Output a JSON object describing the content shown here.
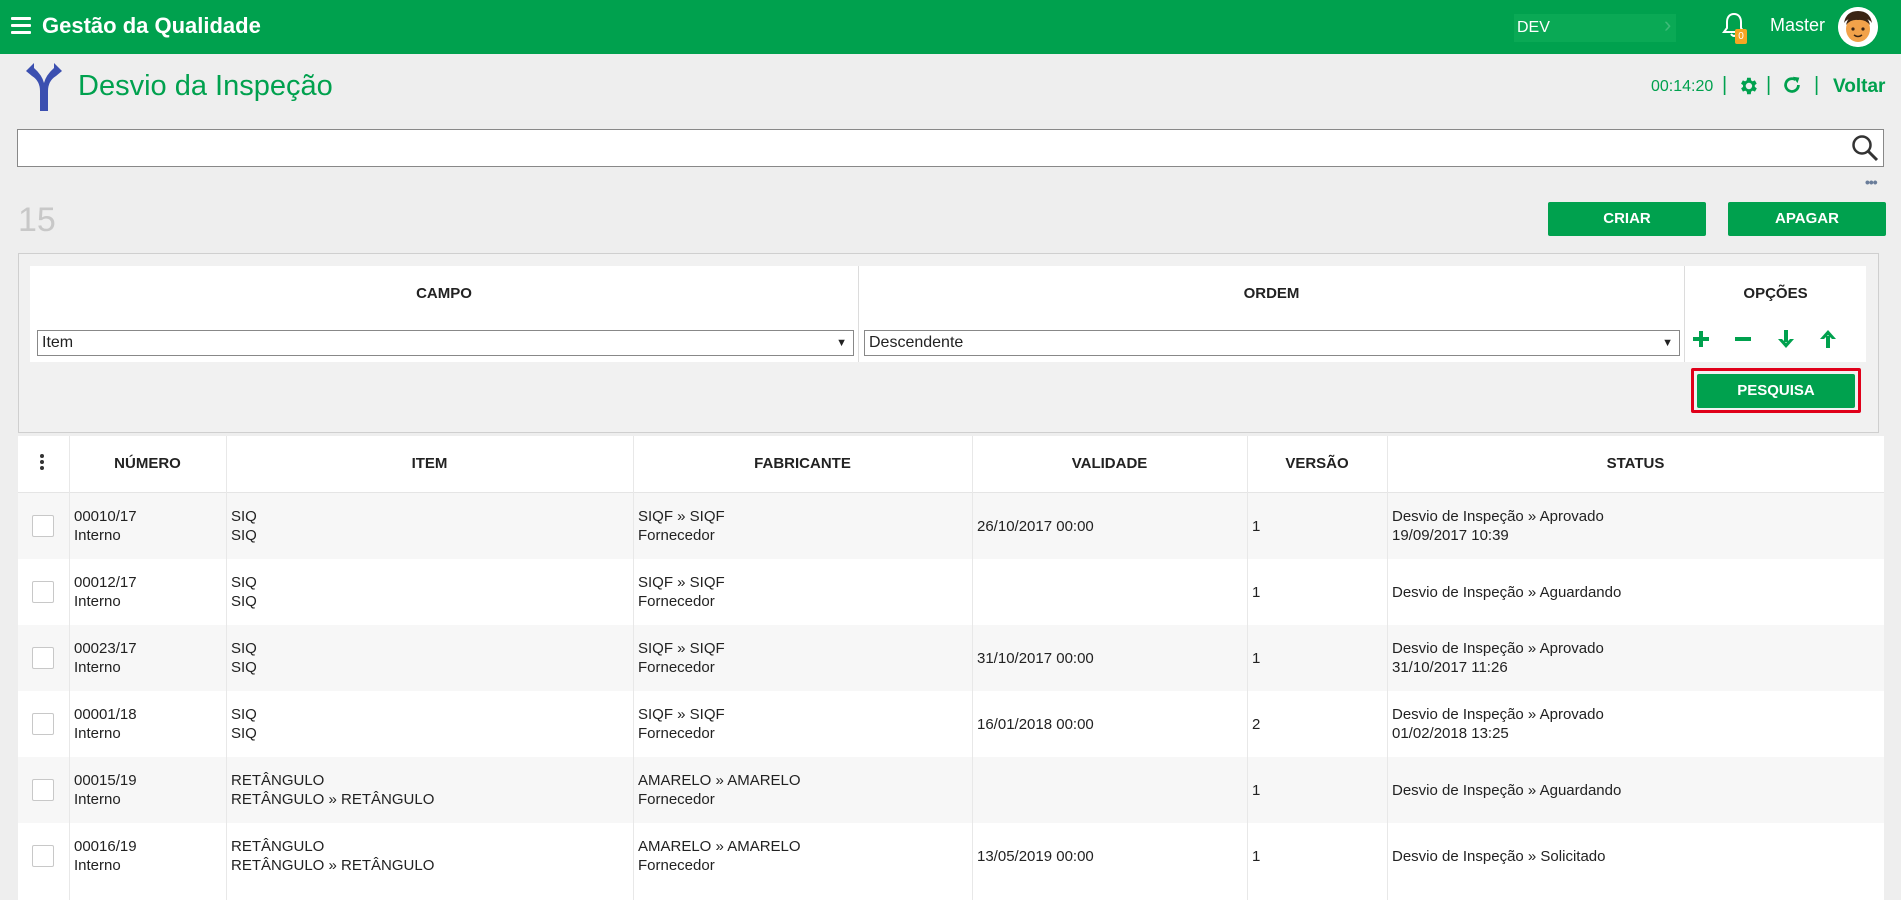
{
  "topbar": {
    "app_title": "Gestão da Qualidade",
    "env": "DEV",
    "notification_count": "0",
    "user": "Master"
  },
  "header": {
    "title": "Desvio da Inspeção",
    "timer": "00:14:20",
    "separator": "|",
    "back_label": "Voltar"
  },
  "search": {
    "value": "",
    "placeholder": ""
  },
  "count": "15",
  "actions": {
    "create": "CRIAR",
    "delete": "APAGAR",
    "search": "PESQUISA"
  },
  "sort": {
    "columns": [
      "CAMPO",
      "ORDEM",
      "OPÇÕES"
    ],
    "field_value": "Item",
    "order_value": "Descendente"
  },
  "table": {
    "columns": [
      "NÚMERO",
      "ITEM",
      "FABRICANTE",
      "VALIDADE",
      "VERSÃO",
      "STATUS"
    ],
    "rows": [
      {
        "numero": "00010/17",
        "origem": "Interno",
        "item1": "SIQ",
        "item2": "SIQ",
        "fab1": "SIQF » SIQF",
        "fab2": "Fornecedor",
        "validade": "26/10/2017 00:00",
        "versao": "1",
        "status1": "Desvio de Inspeção » Aprovado",
        "status2": "19/09/2017 10:39"
      },
      {
        "numero": "00012/17",
        "origem": "Interno",
        "item1": "SIQ",
        "item2": "SIQ",
        "fab1": "SIQF » SIQF",
        "fab2": "Fornecedor",
        "validade": "",
        "versao": "1",
        "status1": "Desvio de Inspeção » Aguardando",
        "status2": ""
      },
      {
        "numero": "00023/17",
        "origem": "Interno",
        "item1": "SIQ",
        "item2": "SIQ",
        "fab1": "SIQF » SIQF",
        "fab2": "Fornecedor",
        "validade": "31/10/2017 00:00",
        "versao": "1",
        "status1": "Desvio de Inspeção » Aprovado",
        "status2": "31/10/2017 11:26"
      },
      {
        "numero": "00001/18",
        "origem": "Interno",
        "item1": "SIQ",
        "item2": "SIQ",
        "fab1": "SIQF » SIQF",
        "fab2": "Fornecedor",
        "validade": "16/01/2018 00:00",
        "versao": "2",
        "status1": "Desvio de Inspeção » Aprovado",
        "status2": "01/02/2018 13:25"
      },
      {
        "numero": "00015/19",
        "origem": "Interno",
        "item1": "RETÂNGULO",
        "item2": "RETÂNGULO » RETÂNGULO",
        "fab1": "AMARELO » AMARELO",
        "fab2": "Fornecedor",
        "validade": "",
        "versao": "1",
        "status1": "Desvio de Inspeção » Aguardando",
        "status2": ""
      },
      {
        "numero": "00016/19",
        "origem": "Interno",
        "item1": "RETÂNGULO",
        "item2": "RETÂNGULO » RETÂNGULO",
        "fab1": "AMARELO » AMARELO",
        "fab2": "Fornecedor",
        "validade": "13/05/2019 00:00",
        "versao": "1",
        "status1": "Desvio de Inspeção » Solicitado",
        "status2": ""
      }
    ]
  },
  "colors": {
    "primary": "#00a14e",
    "highlight": "#e0001a",
    "page_icon": "#3b4fb0"
  }
}
